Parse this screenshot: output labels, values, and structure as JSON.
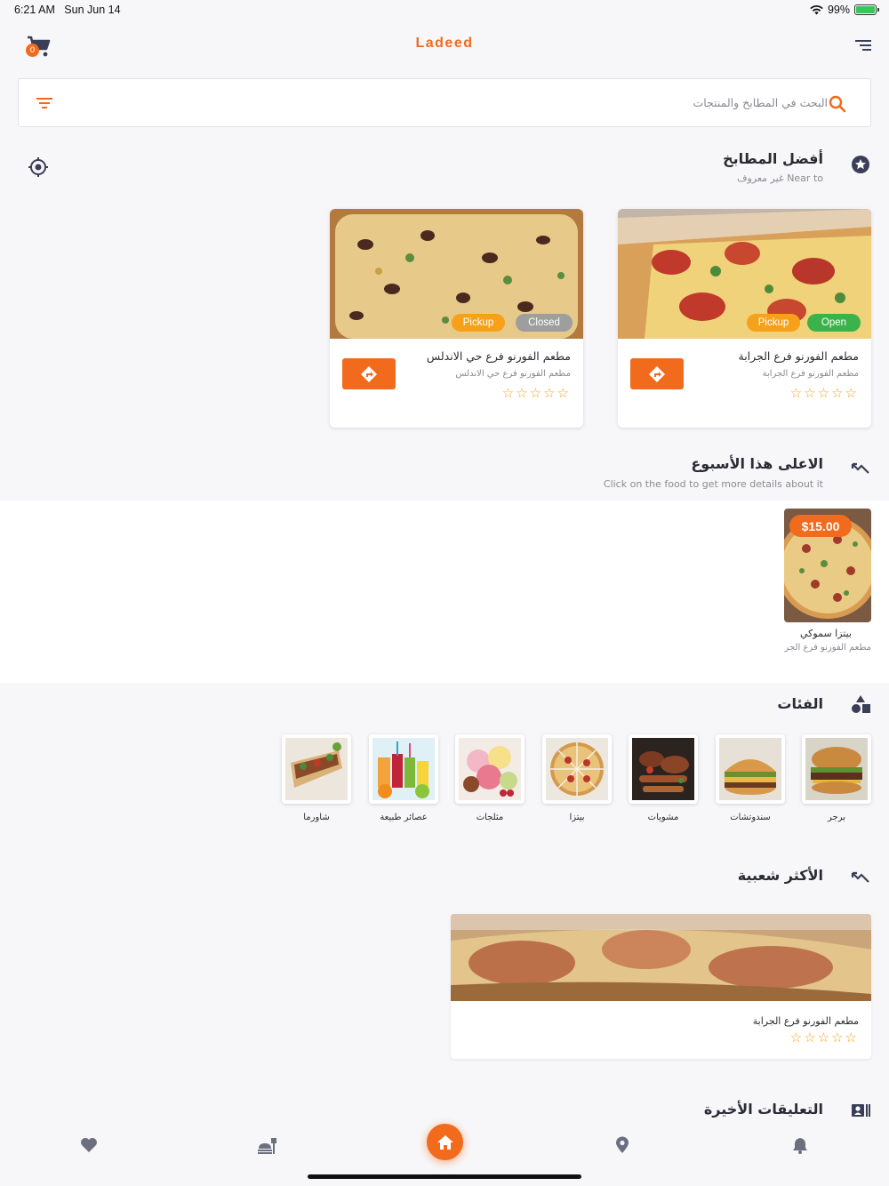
{
  "status": {
    "time": "6:21 AM",
    "date": "Sun Jun 14",
    "battery": "99%"
  },
  "header": {
    "title": "Ladeed",
    "cart_count": "0",
    "cart_icon": "cart-icon",
    "menu_icon": "menu-icon"
  },
  "search": {
    "placeholder": "البحث في المطابخ والمنتجات"
  },
  "best_kitchens": {
    "title": "أفضل المطابخ",
    "near_label": "Near to",
    "near_value": "غير معروف",
    "cards": [
      {
        "name": "مطعم الفورنو فرع الجرابة",
        "branch": "مطعم الفورنو فرع الجرابة",
        "pickup": "Pickup",
        "state": "Open",
        "rating": 0
      },
      {
        "name": "مطعم الفورنو فرع حي الاندلس",
        "branch": "مطعم الفورنو فرع حي الاندلس",
        "pickup": "Pickup",
        "state": "Closed",
        "rating": 0
      }
    ]
  },
  "top_week": {
    "title": "الاعلى هذا الأسبوع",
    "subtitle": "Click on the food to get more details about it",
    "items": [
      {
        "price": "$15.00",
        "name": "بيتزا سموكي",
        "restaurant": "مطعم الفورنو فرع الجرابة"
      }
    ]
  },
  "categories": {
    "title": "الفئات",
    "items": [
      {
        "label": "برجر",
        "icon": "burger"
      },
      {
        "label": "سندوتشات",
        "icon": "sandwich"
      },
      {
        "label": "مشويات",
        "icon": "grill"
      },
      {
        "label": "بيتزا",
        "icon": "pizza"
      },
      {
        "label": "مثلجات",
        "icon": "ice-cream"
      },
      {
        "label": "عصائر طبيعة",
        "icon": "juice"
      },
      {
        "label": "شاورما",
        "icon": "shawarma"
      }
    ]
  },
  "popular": {
    "title": "الأكثر شعبية",
    "items": [
      {
        "restaurant": "مطعم الفورنو فرع الجرابة",
        "rating": 0
      }
    ]
  },
  "recent_comments": {
    "title": "التعليقات الأخيرة"
  },
  "nav": [
    "heart-icon",
    "food-icon",
    "home-icon",
    "location-pin-icon",
    "bell-icon"
  ],
  "colors": {
    "accent": "#f26a1b",
    "star": "#f7a11a",
    "open": "#3bb34a",
    "closed": "#9e9e9e"
  }
}
